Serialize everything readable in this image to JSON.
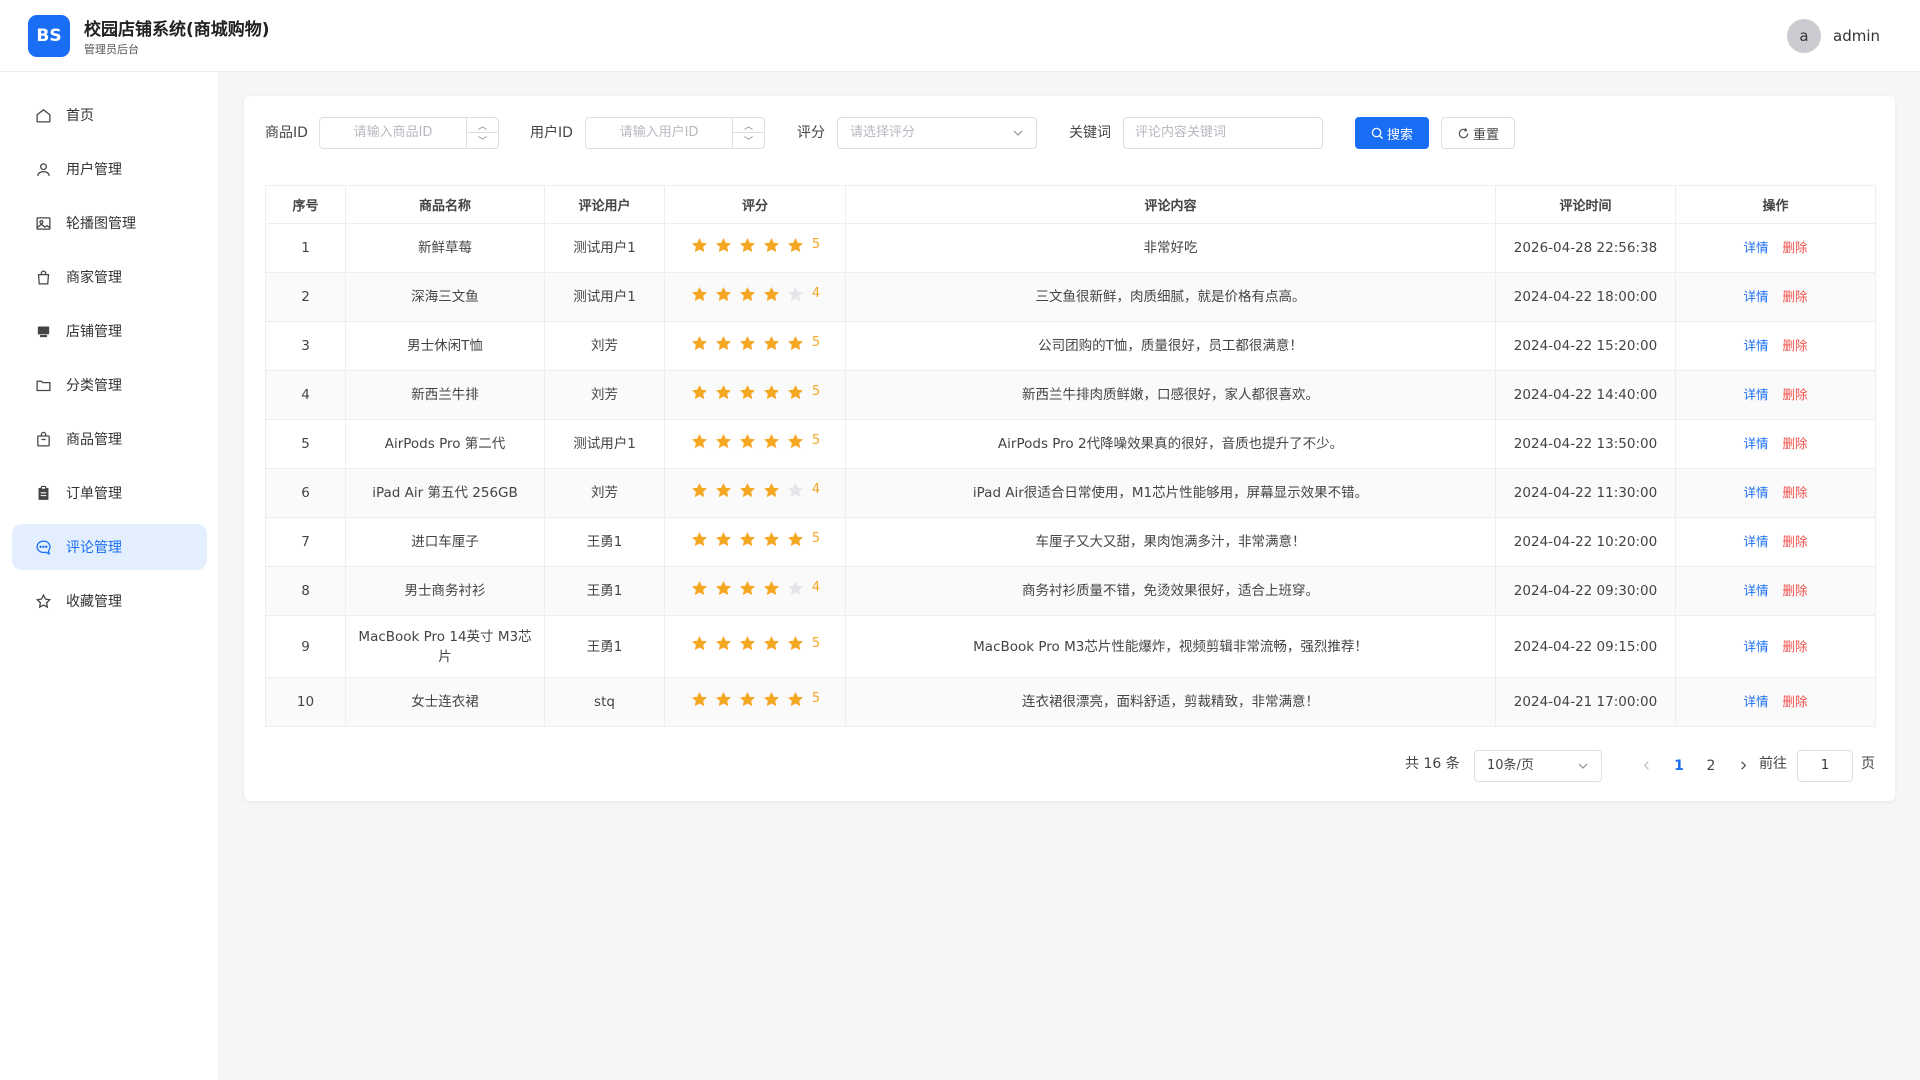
{
  "header": {
    "logo_text": "BS",
    "title": "校园店铺系统(商城购物)",
    "subtitle": "管理员后台",
    "avatar_letter": "a",
    "username": "admin"
  },
  "sidebar": {
    "items": [
      {
        "label": "首页",
        "icon": "home-icon"
      },
      {
        "label": "用户管理",
        "icon": "user-icon"
      },
      {
        "label": "轮播图管理",
        "icon": "image-icon"
      },
      {
        "label": "商家管理",
        "icon": "shopping-bag-icon"
      },
      {
        "label": "店铺管理",
        "icon": "store-icon"
      },
      {
        "label": "分类管理",
        "icon": "folder-icon"
      },
      {
        "label": "商品管理",
        "icon": "goods-icon"
      },
      {
        "label": "订单管理",
        "icon": "clipboard-icon"
      },
      {
        "label": "评论管理",
        "icon": "comment-icon",
        "active": true
      },
      {
        "label": "收藏管理",
        "icon": "star-outline-icon"
      }
    ]
  },
  "filters": {
    "product_id_label": "商品ID",
    "product_id_placeholder": "请输入商品ID",
    "user_id_label": "用户ID",
    "user_id_placeholder": "请输入用户ID",
    "rating_label": "评分",
    "rating_placeholder": "请选择评分",
    "keyword_label": "关键词",
    "keyword_placeholder": "评论内容关键词",
    "search_button": "搜索",
    "reset_button": "重置"
  },
  "table": {
    "columns": [
      "序号",
      "商品名称",
      "评论用户",
      "评分",
      "评论内容",
      "评论时间",
      "操作"
    ],
    "detail_label": "详情",
    "delete_label": "删除",
    "rows": [
      {
        "no": "1",
        "product": "新鲜草莓",
        "user": "测试用户1",
        "rating": 5,
        "content": "非常好吃",
        "time": "2026-04-28 22:56:38"
      },
      {
        "no": "2",
        "product": "深海三文鱼",
        "user": "测试用户1",
        "rating": 4,
        "content": "三文鱼很新鲜，肉质细腻，就是价格有点高。",
        "time": "2024-04-22 18:00:00"
      },
      {
        "no": "3",
        "product": "男士休闲T恤",
        "user": "刘芳",
        "rating": 5,
        "content": "公司团购的T恤，质量很好，员工都很满意！",
        "time": "2024-04-22 15:20:00"
      },
      {
        "no": "4",
        "product": "新西兰牛排",
        "user": "刘芳",
        "rating": 5,
        "content": "新西兰牛排肉质鲜嫩，口感很好，家人都很喜欢。",
        "time": "2024-04-22 14:40:00"
      },
      {
        "no": "5",
        "product": "AirPods Pro 第二代",
        "user": "测试用户1",
        "rating": 5,
        "content": "AirPods Pro 2代降噪效果真的很好，音质也提升了不少。",
        "time": "2024-04-22 13:50:00"
      },
      {
        "no": "6",
        "product": "iPad Air 第五代 256GB",
        "user": "刘芳",
        "rating": 4,
        "content": "iPad Air很适合日常使用，M1芯片性能够用，屏幕显示效果不错。",
        "time": "2024-04-22 11:30:00"
      },
      {
        "no": "7",
        "product": "进口车厘子",
        "user": "王勇1",
        "rating": 5,
        "content": "车厘子又大又甜，果肉饱满多汁，非常满意！",
        "time": "2024-04-22 10:20:00"
      },
      {
        "no": "8",
        "product": "男士商务衬衫",
        "user": "王勇1",
        "rating": 4,
        "content": "商务衬衫质量不错，免烫效果很好，适合上班穿。",
        "time": "2024-04-22 09:30:00"
      },
      {
        "no": "9",
        "product": "MacBook Pro 14英寸 M3芯片",
        "user": "王勇1",
        "rating": 5,
        "content": "MacBook Pro M3芯片性能爆炸，视频剪辑非常流畅，强烈推荐！",
        "time": "2024-04-22 09:15:00"
      },
      {
        "no": "10",
        "product": "女士连衣裙",
        "user": "stq",
        "rating": 5,
        "content": "连衣裙很漂亮，面料舒适，剪裁精致，非常满意！",
        "time": "2024-04-21 17:00:00"
      }
    ]
  },
  "pagination": {
    "total_text": "共 16 条",
    "page_size": "10条/页",
    "pages": [
      "1",
      "2"
    ],
    "current_page": "1",
    "goto_label": "前往",
    "goto_value": "1",
    "page_suffix": "页"
  },
  "colors": {
    "primary": "#1a6ef5",
    "star": "#f5a623",
    "star_empty": "#e4e6ea",
    "danger": "#f0504a",
    "active_bg": "#e3effe"
  }
}
